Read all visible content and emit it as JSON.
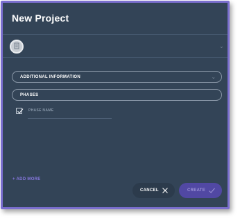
{
  "dialog": {
    "title": "New Project"
  },
  "header": {
    "avatar_icon": "document-icon",
    "expand_icon": "chevron-down-icon"
  },
  "sections": {
    "additional_information": "ADDITIONAL INFORMATION",
    "phases": "PHASES"
  },
  "phases": {
    "items": [
      {
        "checked": true,
        "placeholder": "PHASE NAME"
      }
    ],
    "add_more_label": "+ ADD MORE"
  },
  "footer": {
    "cancel_label": "CANCEL",
    "create_label": "CREATE"
  },
  "colors": {
    "frame_border": "#7b6fcf",
    "dialog_background": "#334457",
    "accent": "#8778e0",
    "create_button": "#5148a3",
    "cancel_button": "#2c3b4c"
  }
}
